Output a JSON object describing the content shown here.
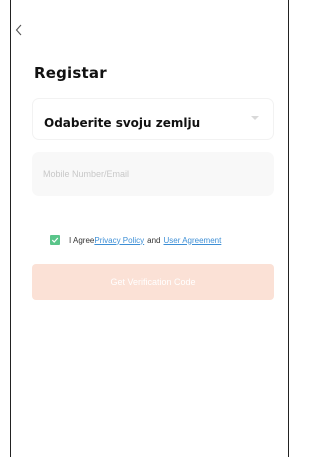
{
  "page": {
    "title": "Registar"
  },
  "icons": {
    "back": "chevron-left-icon",
    "select_caret": "caret-down-icon",
    "checkbox": "checkmark-icon"
  },
  "country_select": {
    "value": "Odaberite svoju zemlju"
  },
  "mobile_input": {
    "placeholder": "Mobile Number/Email",
    "value": ""
  },
  "agreement": {
    "checked": true,
    "prefix": "I Agree",
    "privacy_link": "Privacy Policy",
    "and_text": "and",
    "user_agreement_link": "User Agreement"
  },
  "actions": {
    "verify_label": "Get Verification Code"
  },
  "colors": {
    "accent_disabled": "#fbe1d6",
    "checkbox": "#5ac58a",
    "link": "#3d8fd6",
    "input_bg": "#f8f8f8"
  }
}
